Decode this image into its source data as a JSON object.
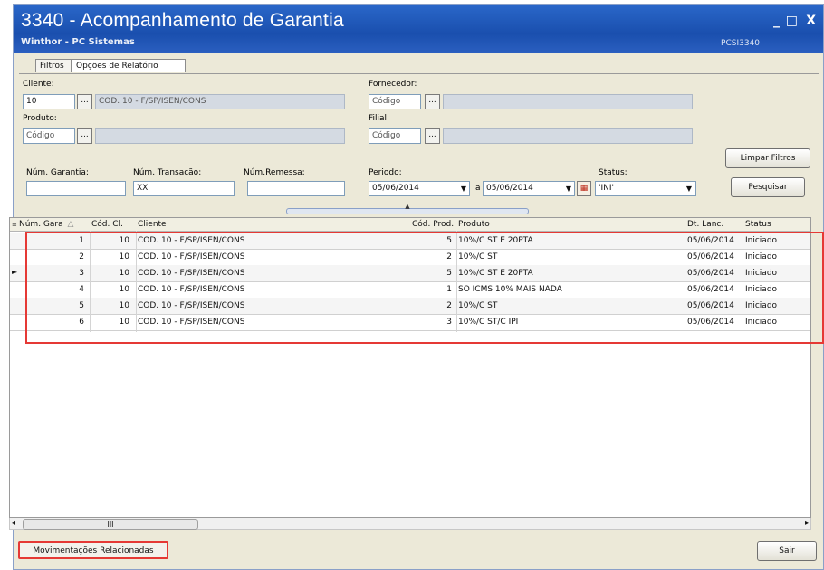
{
  "window": {
    "title": "3340 - Acompanhamento de Garantia",
    "subtitle": "Winthor - PC Sistemas",
    "routine": "PCSI3340",
    "minimize": "_",
    "maximize": "□",
    "close": "X"
  },
  "tabs": [
    {
      "label": "Filtros"
    },
    {
      "label": "Opções de Relatório"
    }
  ],
  "filters": {
    "cliente_label": "Cliente:",
    "cliente_code": "10",
    "cliente_desc": "COD. 10 - F/SP/ISEN/CONS",
    "fornecedor_label": "Fornecedor:",
    "fornecedor_placeholder": "Código",
    "produto_label": "Produto:",
    "produto_placeholder": "Código",
    "filial_label": "Filial:",
    "filial_placeholder": "Código",
    "num_garantia_label": "Núm. Garantia:",
    "num_transacao_label": "Núm. Transação:",
    "num_transacao_value": "XX",
    "num_remessa_label": "Núm.Remessa:",
    "periodo_label": "Periodo:",
    "periodo_from": "05/06/2014",
    "periodo_sep": "a",
    "periodo_to": "05/06/2014",
    "status_label": "Status:",
    "status_value": "'INI'",
    "ellipsis": "..."
  },
  "buttons": {
    "limpar": "Limpar Filtros",
    "pesquisar": "Pesquisar",
    "movimentacoes": "Movimentações Relacionadas",
    "sair": "Sair"
  },
  "grid": {
    "headers": [
      "Núm. Gara",
      "Cód. Cl.",
      "Cliente",
      "Cód. Prod.",
      "Produto",
      "Dt. Lanc.",
      "Status"
    ],
    "rows": [
      [
        "1",
        "10",
        "COD. 10 - F/SP/ISEN/CONS",
        "5",
        "10%/C ST E 20PTA",
        "05/06/2014",
        "Iniciado"
      ],
      [
        "2",
        "10",
        "COD. 10 - F/SP/ISEN/CONS",
        "2",
        "10%/C ST",
        "05/06/2014",
        "Iniciado"
      ],
      [
        "3",
        "10",
        "COD. 10 - F/SP/ISEN/CONS",
        "5",
        "10%/C ST E 20PTA",
        "05/06/2014",
        "Iniciado"
      ],
      [
        "4",
        "10",
        "COD. 10 - F/SP/ISEN/CONS",
        "1",
        "SO ICMS 10% MAIS NADA",
        "05/06/2014",
        "Iniciado"
      ],
      [
        "5",
        "10",
        "COD. 10 - F/SP/ISEN/CONS",
        "2",
        "10%/C ST",
        "05/06/2014",
        "Iniciado"
      ],
      [
        "6",
        "10",
        "COD. 10 - F/SP/ISEN/CONS",
        "3",
        "10%/C ST/C IPI",
        "05/06/2014",
        "Iniciado"
      ]
    ],
    "selected_row": 3,
    "scroll_thumb": "III"
  },
  "colors": {
    "titlebar": "#1a4fae",
    "highlight": "#e53935"
  }
}
